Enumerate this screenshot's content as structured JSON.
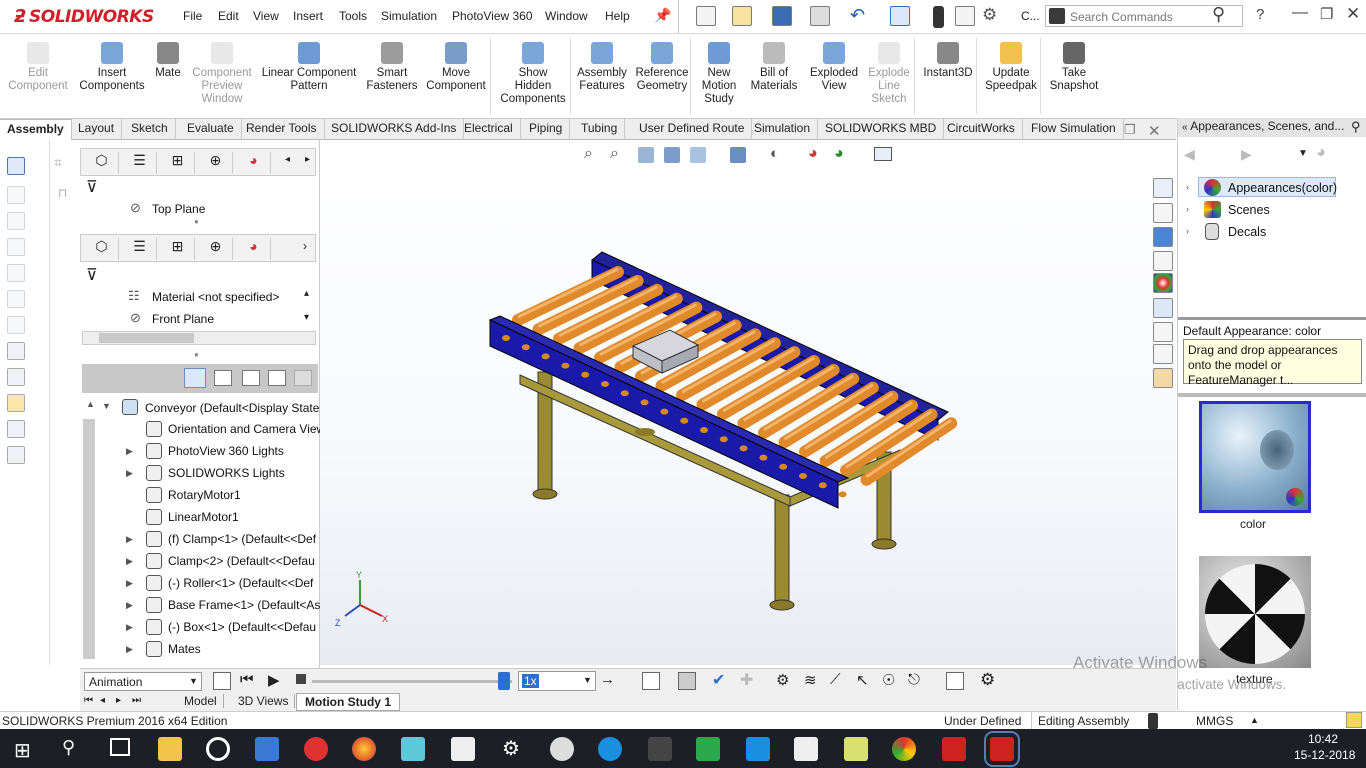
{
  "app": {
    "logo": "SOLIDWORKS"
  },
  "menu": [
    "File",
    "Edit",
    "View",
    "Insert",
    "Tools",
    "Simulation",
    "PhotoView 360",
    "Window",
    "Help"
  ],
  "search": {
    "short_label": "C...",
    "placeholder": "Search Commands"
  },
  "ribbon": [
    {
      "label": "Edit Component",
      "disabled": true
    },
    {
      "label": "Insert Components",
      "disabled": false
    },
    {
      "label": "Mate",
      "disabled": false
    },
    {
      "label": "Component Preview Window",
      "disabled": true
    },
    {
      "label": "Linear Component Pattern",
      "disabled": false
    },
    {
      "label": "Smart Fasteners",
      "disabled": false
    },
    {
      "label": "Move Component",
      "disabled": false
    },
    {
      "label": "Show Hidden Components",
      "disabled": false
    },
    {
      "label": "Assembly Features",
      "disabled": false
    },
    {
      "label": "Reference Geometry",
      "disabled": false
    },
    {
      "label": "New Motion Study",
      "disabled": false
    },
    {
      "label": "Bill of Materials",
      "disabled": false
    },
    {
      "label": "Exploded View",
      "disabled": false
    },
    {
      "label": "Explode Line Sketch",
      "disabled": true
    },
    {
      "label": "Instant3D",
      "disabled": false
    },
    {
      "label": "Update Speedpak",
      "disabled": false
    },
    {
      "label": "Take Snapshot",
      "disabled": false
    }
  ],
  "tabs": [
    "Assembly",
    "Layout",
    "Sketch",
    "Evaluate",
    "Render Tools",
    "SOLIDWORKS Add-Ins",
    "Electrical",
    "Piping",
    "Tubing",
    "User Defined Route",
    "Simulation",
    "SOLIDWORKS MBD",
    "CircuitWorks",
    "Flow Simulation"
  ],
  "active_tab": "Assembly",
  "feature_manager": {
    "pane1_row": "Top Plane",
    "pane2_rows": [
      "Material <not specified>",
      "Front Plane"
    ],
    "tree_root": "Conveyor  (Default<Display State",
    "tree": [
      "Orientation and Camera View",
      "PhotoView 360 Lights",
      "SOLIDWORKS Lights",
      "RotaryMotor1",
      "LinearMotor1",
      "(f) Clamp<1> (Default<<Def",
      "Clamp<2> (Default<<Defau",
      "(-) Roller<1> (Default<<Def",
      "Base Frame<1> (Default<As",
      "(-) Box<1> (Default<<Defau",
      "Mates"
    ]
  },
  "right_pane": {
    "title": "Appearances, Scenes, and...",
    "items": [
      "Appearances(color)",
      "Scenes",
      "Decals"
    ],
    "default_label": "Default Appearance: color",
    "tooltip": "Drag and drop appearances onto the model or FeatureManager t...",
    "swatches": [
      "color",
      "texture"
    ]
  },
  "animation": {
    "mode": "Animation",
    "speed": "1x"
  },
  "bottom_tabs": [
    "Model",
    "3D Views",
    "Motion Study 1"
  ],
  "status": {
    "edition": "SOLIDWORKS Premium 2016 x64 Edition",
    "state": "Under Defined",
    "mode": "Editing Assembly",
    "units": "MMGS"
  },
  "watermark": {
    "line1": "Activate Windows",
    "line2": "Go to Settings to activate Windows."
  },
  "clock": {
    "time": "10:42",
    "date": "15-12-2018"
  },
  "colors": {
    "rail": "#1a1aa8",
    "roller": "#e08a2c",
    "legs": "#8a7a2a",
    "logo_red": "#d0202a"
  }
}
